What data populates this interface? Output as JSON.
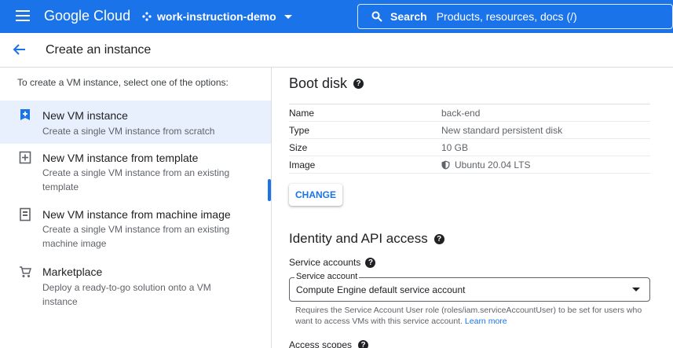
{
  "topbar": {
    "brand": "Google Cloud",
    "project": "work-instruction-demo",
    "search_label": "Search",
    "search_hint": "Products, resources, docs (/)"
  },
  "subheader": {
    "title": "Create an instance"
  },
  "left": {
    "intro": "To create a VM instance, select one of the options:",
    "options": [
      {
        "title": "New VM instance",
        "desc": "Create a single VM instance from scratch",
        "icon": "add-box-icon"
      },
      {
        "title": "New VM instance from template",
        "desc": "Create a single VM instance from an existing template",
        "icon": "template-icon"
      },
      {
        "title": "New VM instance from machine image",
        "desc": "Create a single VM instance from an existing machine image",
        "icon": "machine-image-icon"
      },
      {
        "title": "Marketplace",
        "desc": "Deploy a ready-to-go solution onto a VM instance",
        "icon": "cart-icon"
      }
    ]
  },
  "boot_disk": {
    "heading": "Boot disk",
    "rows": [
      {
        "key": "Name",
        "value": "back-end"
      },
      {
        "key": "Type",
        "value": "New standard persistent disk"
      },
      {
        "key": "Size",
        "value": "10 GB"
      },
      {
        "key": "Image",
        "value": "Ubuntu 20.04 LTS"
      }
    ],
    "change_label": "CHANGE"
  },
  "identity": {
    "heading": "Identity and API access",
    "service_accounts_label": "Service accounts",
    "select_label": "Service account",
    "select_value": "Compute Engine default service account",
    "hint_text": "Requires the Service Account User role (roles/iam.serviceAccountUser) to be set for users who want to access VMs with this service account.",
    "learn_more": "Learn more",
    "access_scopes_label": "Access scopes"
  },
  "colors": {
    "accent": "#1a73e8",
    "selected_bg": "#e8f0fe"
  }
}
